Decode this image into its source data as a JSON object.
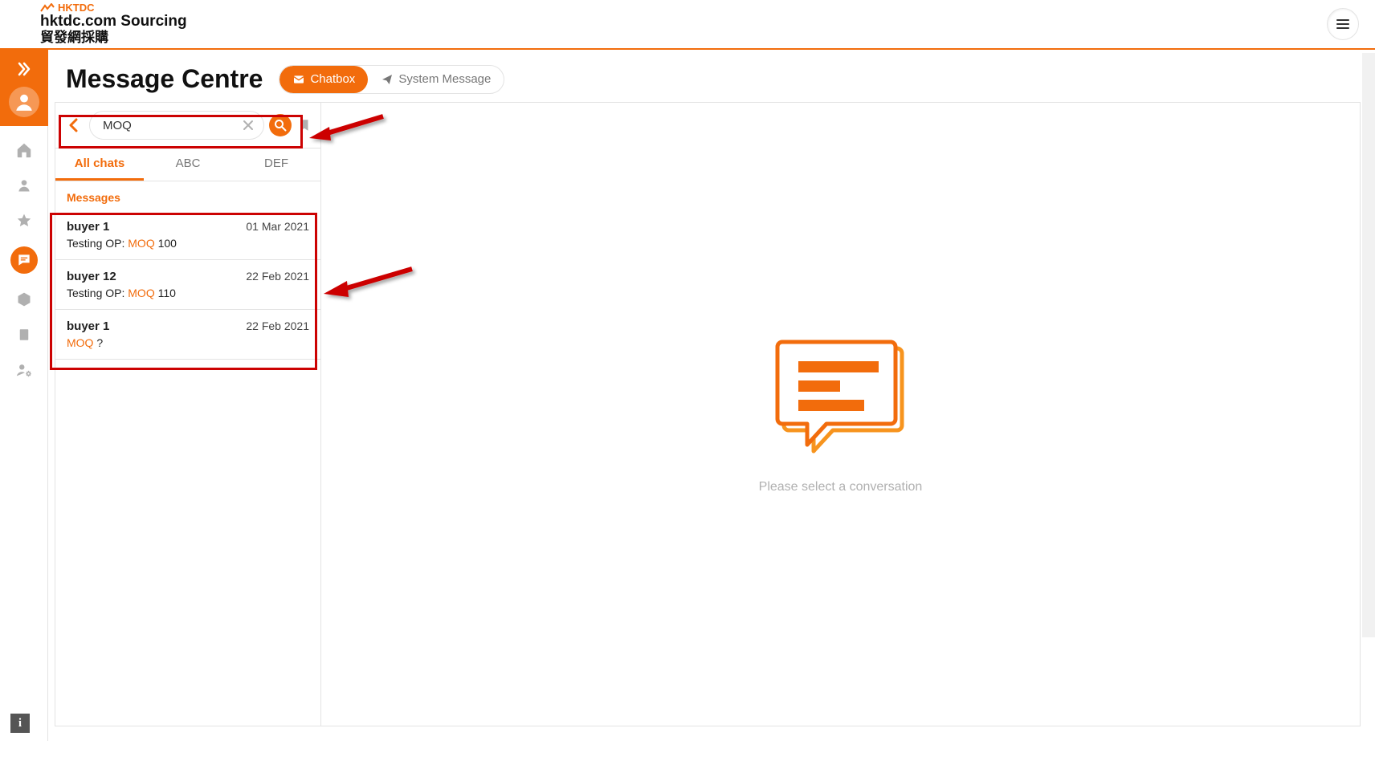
{
  "logo": {
    "brand": "HKTDC",
    "main": "hktdc.com Sourcing",
    "sub": "貿發網採購"
  },
  "page_title": "Message Centre",
  "tabs": {
    "chatbox": "Chatbox",
    "system": "System Message"
  },
  "search": {
    "value": "MOQ",
    "placeholder": ""
  },
  "sub_tabs": [
    "All chats",
    "ABC",
    "DEF"
  ],
  "section_heading": "Messages",
  "messages": [
    {
      "name": "buyer 1",
      "date": "01 Mar 2021",
      "preview_pre": "Testing OP: ",
      "preview_hl": "MOQ",
      "preview_post": " 100"
    },
    {
      "name": "buyer 12",
      "date": "22 Feb 2021",
      "preview_pre": "Testing OP: ",
      "preview_hl": "MOQ",
      "preview_post": " 110"
    },
    {
      "name": "buyer 1",
      "date": "22 Feb 2021",
      "preview_pre": "",
      "preview_hl": "MOQ",
      "preview_post": " ?"
    }
  ],
  "empty_caption": "Please select a conversation",
  "info_label": "i"
}
